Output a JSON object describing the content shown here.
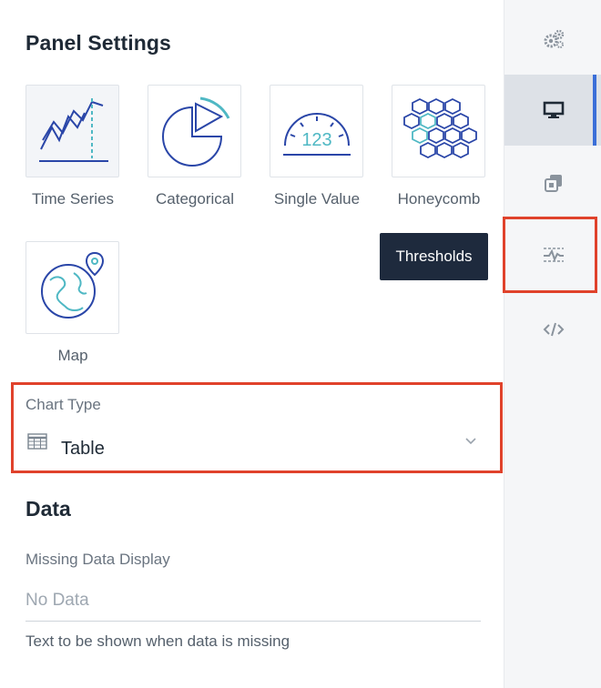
{
  "panel": {
    "title": "Panel Settings",
    "tiles": [
      {
        "label": "Time Series"
      },
      {
        "label": "Categorical"
      },
      {
        "label": "Single Value",
        "glyph_text": "123"
      },
      {
        "label": "Honeycomb"
      },
      {
        "label": "Map"
      }
    ]
  },
  "tooltip": {
    "text": "Thresholds"
  },
  "chart_type": {
    "label": "Chart Type",
    "value": "Table",
    "icon": "table-icon"
  },
  "data_section": {
    "title": "Data",
    "missing_label": "Missing Data Display",
    "missing_placeholder": "No Data",
    "help_text": "Text to be shown when data is missing"
  },
  "rail": {
    "items": [
      {
        "icon": "gears-icon"
      },
      {
        "icon": "monitor-icon",
        "active": true
      },
      {
        "icon": "layers-icon"
      },
      {
        "icon": "thresholds-icon"
      },
      {
        "icon": "code-icon"
      }
    ]
  },
  "colors": {
    "accent": "#3b6fd8",
    "highlight": "#e0422b",
    "icon_blue": "#2a46a8",
    "icon_teal": "#4fb8c4",
    "tooltip_bg": "#1e2a3d"
  }
}
